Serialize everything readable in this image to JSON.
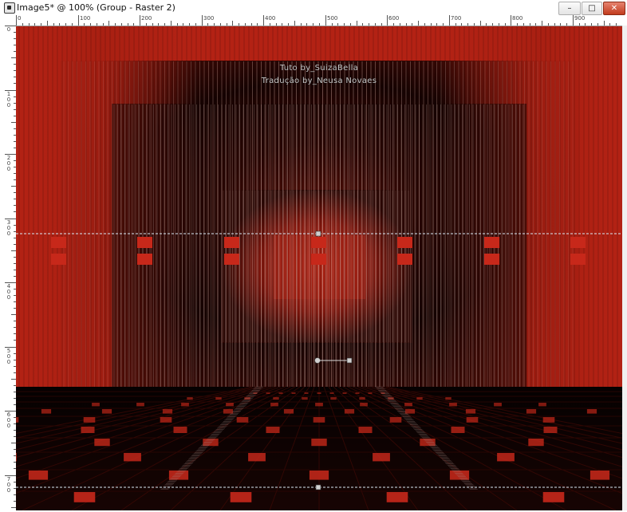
{
  "window": {
    "title": "Image5* @ 100% (Group - Raster 2)",
    "controls": {
      "minimize": "–",
      "maximize": "□",
      "close": "✕"
    }
  },
  "rulers": {
    "horizontal_labels": [
      "0",
      "100",
      "200",
      "300",
      "400",
      "500",
      "600",
      "700",
      "800",
      "900"
    ],
    "vertical_labels": [
      "0",
      "100",
      "200",
      "300",
      "400",
      "500",
      "600",
      "700"
    ]
  },
  "canvas": {
    "watermark_line1": "Tuto by_SuizaBella",
    "watermark_line2": "Tradução by_Neusa Novaes",
    "colors": {
      "primary_red": "#b32214",
      "dark": "#120302",
      "guide": "#cfe3f2",
      "tile": "#c7281a"
    }
  }
}
